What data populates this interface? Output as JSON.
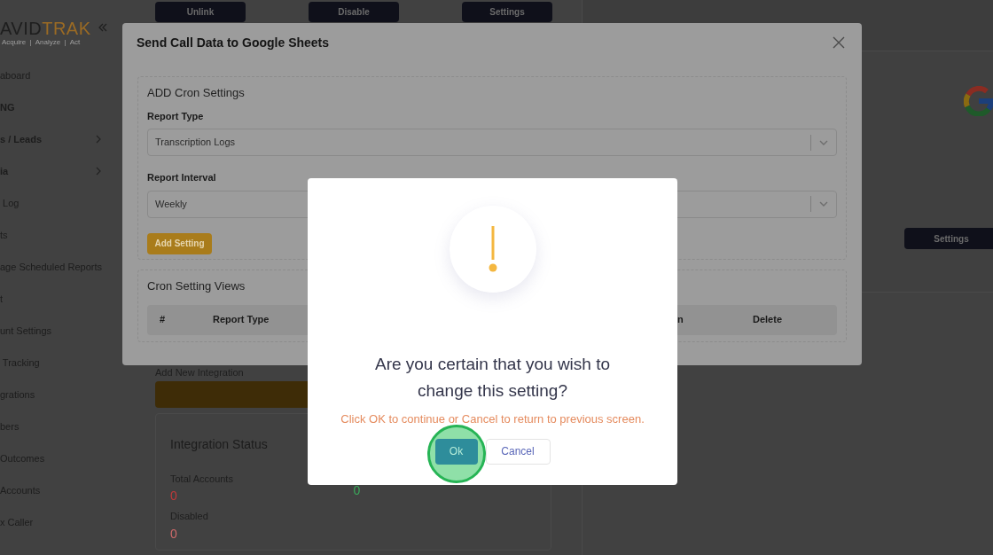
{
  "sidebar": {
    "logo": {
      "brand_a": "AVID",
      "brand_b": "TRAK",
      "tagline": "Acquire  |  Analyze  |  Act"
    },
    "items": [
      {
        "label": "aboard",
        "kind": "link"
      },
      {
        "label": "NG",
        "kind": "section"
      },
      {
        "label": "s / Leads",
        "kind": "group",
        "expanded": false
      },
      {
        "label": "ia",
        "kind": "group",
        "expanded": false
      },
      {
        "label": " Log",
        "kind": "link"
      },
      {
        "label": "ts",
        "kind": "link"
      },
      {
        "label": "age Scheduled Reports",
        "kind": "link"
      },
      {
        "label": "t",
        "kind": "link"
      },
      {
        "label": "unt Settings",
        "kind": "link"
      },
      {
        "label": " Tracking",
        "kind": "link"
      },
      {
        "label": "grations",
        "kind": "link"
      },
      {
        "label": "bers",
        "kind": "link"
      },
      {
        "label": "Outcomes",
        "kind": "link"
      },
      {
        "label": "Accounts",
        "kind": "link"
      },
      {
        "label": "x Caller",
        "kind": "link"
      }
    ]
  },
  "top_buttons": [
    "Unlink",
    "Disable",
    "Settings"
  ],
  "integration_card": {
    "button": "Settings"
  },
  "add_integration": {
    "label": "Add New Integration"
  },
  "status": {
    "title": "Integration Status",
    "stats": [
      {
        "label": "Total Accounts",
        "value": "0",
        "color": "#c03a3a"
      },
      {
        "value": "0",
        "color": "#3aa85a"
      },
      {
        "label": "Disabled",
        "value": "0",
        "color": "#d06a6a"
      }
    ]
  },
  "modal": {
    "title": "Send Call Data to Google Sheets",
    "add_section": {
      "title": "ADD Cron Settings",
      "fields": [
        {
          "label": "Report Type",
          "value": "Transcription Logs"
        },
        {
          "label": "Report Interval",
          "value": "Weekly"
        }
      ],
      "button": "Add Setting"
    },
    "views_section": {
      "title": "Cron Setting Views",
      "columns": [
        "#",
        "Report Type",
        "n",
        "Delete"
      ]
    }
  },
  "alert": {
    "title": "Are you certain that you wish to change this setting?",
    "message": "Click OK to continue or Cancel to return to previous screen.",
    "buttons": [
      {
        "label": "Ok",
        "kind": "confirm",
        "highlighted": true
      },
      {
        "label": "Cancel",
        "kind": "cancel",
        "highlighted": false
      }
    ]
  }
}
